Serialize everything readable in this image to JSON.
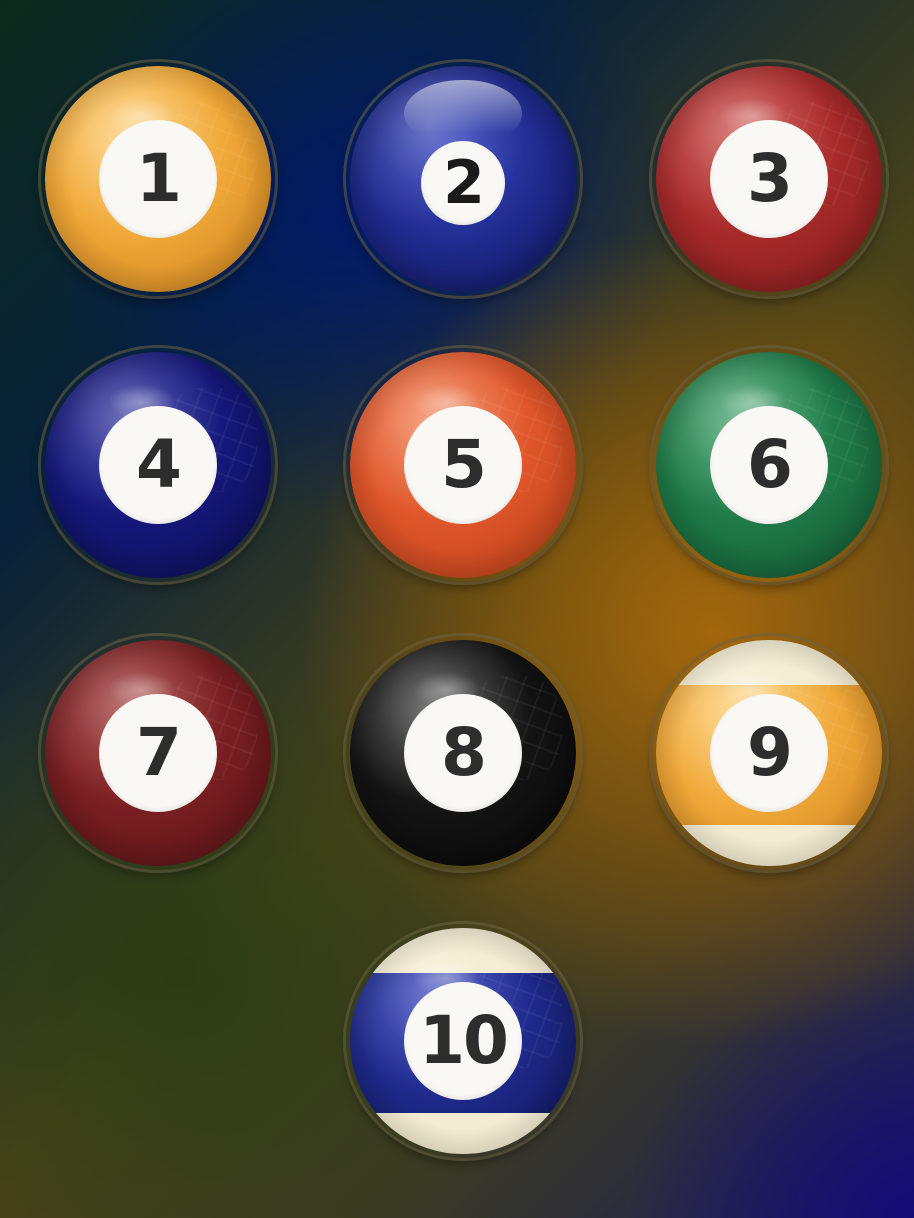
{
  "balls": [
    {
      "number": "1",
      "color": "#f0a838",
      "stripe": false
    },
    {
      "number": "2",
      "color": "#1f2a8c",
      "stripe": false,
      "glossy": true
    },
    {
      "number": "3",
      "color": "#a82a2a",
      "stripe": false
    },
    {
      "number": "4",
      "color": "#15187a",
      "stripe": false
    },
    {
      "number": "5",
      "color": "#e0562a",
      "stripe": false
    },
    {
      "number": "6",
      "color": "#1f7a48",
      "stripe": false
    },
    {
      "number": "7",
      "color": "#7a1f22",
      "stripe": false
    },
    {
      "number": "8",
      "color": "#141414",
      "stripe": false
    },
    {
      "number": "9",
      "color": "#f0a838",
      "stripe": true
    },
    {
      "number": "10",
      "color": "#1f2a8c",
      "stripe": true
    }
  ]
}
